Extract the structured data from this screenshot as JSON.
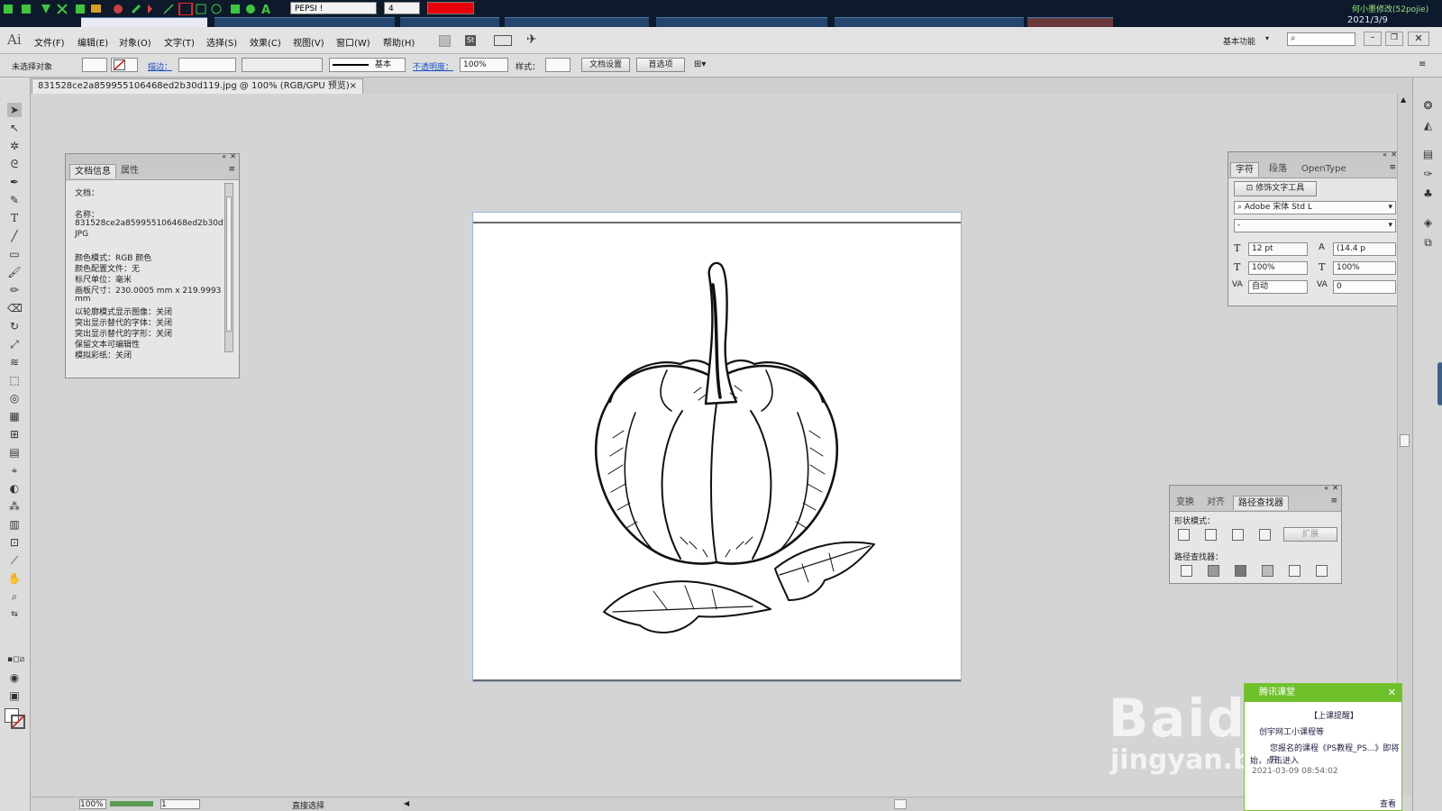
{
  "taskbar": {
    "font_combo": "PEPSI !",
    "size_combo": "4",
    "color_swatch": "#e8000a",
    "clock_date": "2021/3/9",
    "user_caption": "何小墨修改(52pojie)"
  },
  "menubar": {
    "app_logo": "Ai",
    "items": [
      "文件(F)",
      "编辑(E)",
      "对象(O)",
      "文字(T)",
      "选择(S)",
      "效果(C)",
      "视图(V)",
      "窗口(W)",
      "帮助(H)"
    ],
    "workspace": "基本功能",
    "search_placeholder": ""
  },
  "control": {
    "selection_status": "未选择对象",
    "stroke_label": "描边：",
    "stroke_style": "基本",
    "opacity_label": "不透明度：",
    "opacity_value": "100%",
    "style_label": "样式：",
    "doc_setup_button": "文档设置",
    "prefs_button": "首选项"
  },
  "document": {
    "tab_title": "831528ce2a859955106468ed2b30d119.jpg @ 100% (RGB/GPU 预览)",
    "close_glyph": "×"
  },
  "doc_info_panel": {
    "tab_active": "文档信息",
    "tab_inactive": "属性",
    "lines": [
      "文档：",
      "",
      "名称：",
      "831528ce2a859955106468ed2b30d119.",
      "JPG",
      "",
      "颜色模式：RGB 颜色",
      "颜色配置文件：无",
      "标尺单位：毫米",
      "画板尺寸：230.0005 mm x 219.9993",
      "mm",
      "以轮廓模式显示图像：关闭",
      "突出显示替代的字体：关闭",
      "突出显示替代的字形：关闭",
      "保留文本可编辑性",
      "模拟彩纸：关闭"
    ]
  },
  "character_panel": {
    "tabs": [
      "字符",
      "段落",
      "OpenType"
    ],
    "touch_type_button": "修饰文字工具",
    "font_family": "Adobe 宋体 Std L",
    "font_style": "-",
    "font_size": "12 pt",
    "leading": "(14.4 p",
    "vertical_scale": "100%",
    "horizontal_scale": "100%",
    "kerning": "自动",
    "tracking": "0"
  },
  "pathfinder_panel": {
    "tabs": [
      "变换",
      "对齐",
      "路径查找器"
    ],
    "shape_modes_label": "形状模式：",
    "expand_button": "扩展",
    "pathfinders_label": "路径查找器："
  },
  "status": {
    "zoom": "100%",
    "artboard_number": "1",
    "tool_name": "直接选择"
  },
  "notification": {
    "title": "腾讯课堂",
    "line1": "【上课提醒】",
    "line2": "创宇网工小课程等",
    "line3": "您报名的课程《PS教程_PS...》即将开",
    "line4": "始，点击进入",
    "time": "2021-03-09 08:54:02",
    "view_link": "查看"
  },
  "watermark": {
    "brand": "Baidu经验",
    "site": "jingyan.baidu.com"
  }
}
